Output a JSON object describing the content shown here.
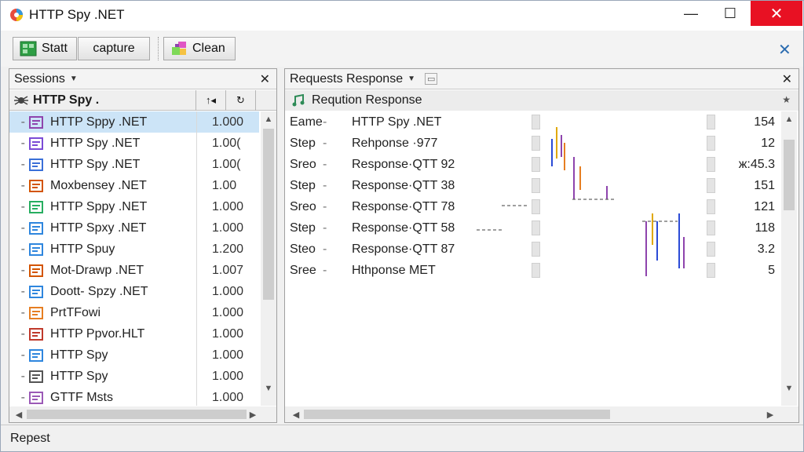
{
  "window": {
    "title": "HTTP Spy .NET",
    "minimize": "—",
    "maximize": "☐",
    "close": "✕"
  },
  "toolbar": {
    "start_label": "Statt",
    "capture_label": "capture",
    "clean_label": "Clean",
    "close": "✕"
  },
  "sessions": {
    "header": "Sessions",
    "close": "✕",
    "sub_title": "HTTP Spy .",
    "sort_icon": "↑◂",
    "refresh_icon": "↻",
    "rows": [
      {
        "name": "HTTP Sppy .NET",
        "value": "1.000",
        "icon_color": "#8e44ad",
        "selected": true
      },
      {
        "name": "HTTP Spy .NET",
        "value": "1.00(",
        "icon_color": "#7b4bd6",
        "selected": false
      },
      {
        "name": "HTTP Spy .NET",
        "value": "1.00(",
        "icon_color": "#3a6fd8",
        "selected": false
      },
      {
        "name": "Moxbensey .NET",
        "value": "1.00",
        "icon_color": "#d35400",
        "selected": false
      },
      {
        "name": "HTTP Sppy .NET",
        "value": "1.000",
        "icon_color": "#27ae60",
        "selected": false
      },
      {
        "name": "HTTP Spxy .NET",
        "value": "1.000",
        "icon_color": "#2e86de",
        "selected": false
      },
      {
        "name": "HTTP Spuy",
        "value": "1.200",
        "icon_color": "#2e86de",
        "selected": false
      },
      {
        "name": "Mot-Drawp .NET",
        "value": "1.007",
        "icon_color": "#d35400",
        "selected": false
      },
      {
        "name": "Doott- Spzy .NET",
        "value": "1.000",
        "icon_color": "#2e86de",
        "selected": false
      },
      {
        "name": "PrtTFowi",
        "value": "1.000",
        "icon_color": "#e67e22",
        "selected": false
      },
      {
        "name": "HTTP Ppvor.HLT",
        "value": "1.000",
        "icon_color": "#c0392b",
        "selected": false
      },
      {
        "name": "HTTP Spy",
        "value": "1.000",
        "icon_color": "#2e86de",
        "selected": false
      },
      {
        "name": "HTTP Spy",
        "value": "1.000",
        "icon_color": "#555555",
        "selected": false
      },
      {
        "name": "GTTF Msts",
        "value": "1.000",
        "icon_color": "#9b59b6",
        "selected": false
      }
    ]
  },
  "requests": {
    "header": "Requests Response",
    "close": "✕",
    "sub_title": "Reqution Response",
    "pin_icon": "★",
    "rows": [
      {
        "c1": "Eame",
        "c2": "-",
        "c3": "HTTP Spy .NET",
        "c4": "154"
      },
      {
        "c1": "Step",
        "c2": "-",
        "c3": "Rehponse ·977",
        "c4": "12"
      },
      {
        "c1": "Sreo",
        "c2": "-",
        "c3": "Response·QTT 92",
        "c4": "ж:45.3"
      },
      {
        "c1": "Step",
        "c2": "-",
        "c3": "Response·QTT 38",
        "c4": "151"
      },
      {
        "c1": "Sreo",
        "c2": "-",
        "c3": "Response·QTT 78",
        "c4": "121"
      },
      {
        "c1": "Step",
        "c2": "-",
        "c3": "Response·QTT 58",
        "c4": "118"
      },
      {
        "c1": "Steo",
        "c2": "-",
        "c3": "Response·QTT 87",
        "c4": "3.2"
      },
      {
        "c1": "Sree",
        "c2": "-",
        "c3": "Hthponse MET",
        "c4": "5"
      }
    ]
  },
  "status": {
    "text": "Repest"
  },
  "colors": {
    "accent": "#2b6cb0",
    "selection": "#cce4f7",
    "close_red": "#e81123"
  }
}
